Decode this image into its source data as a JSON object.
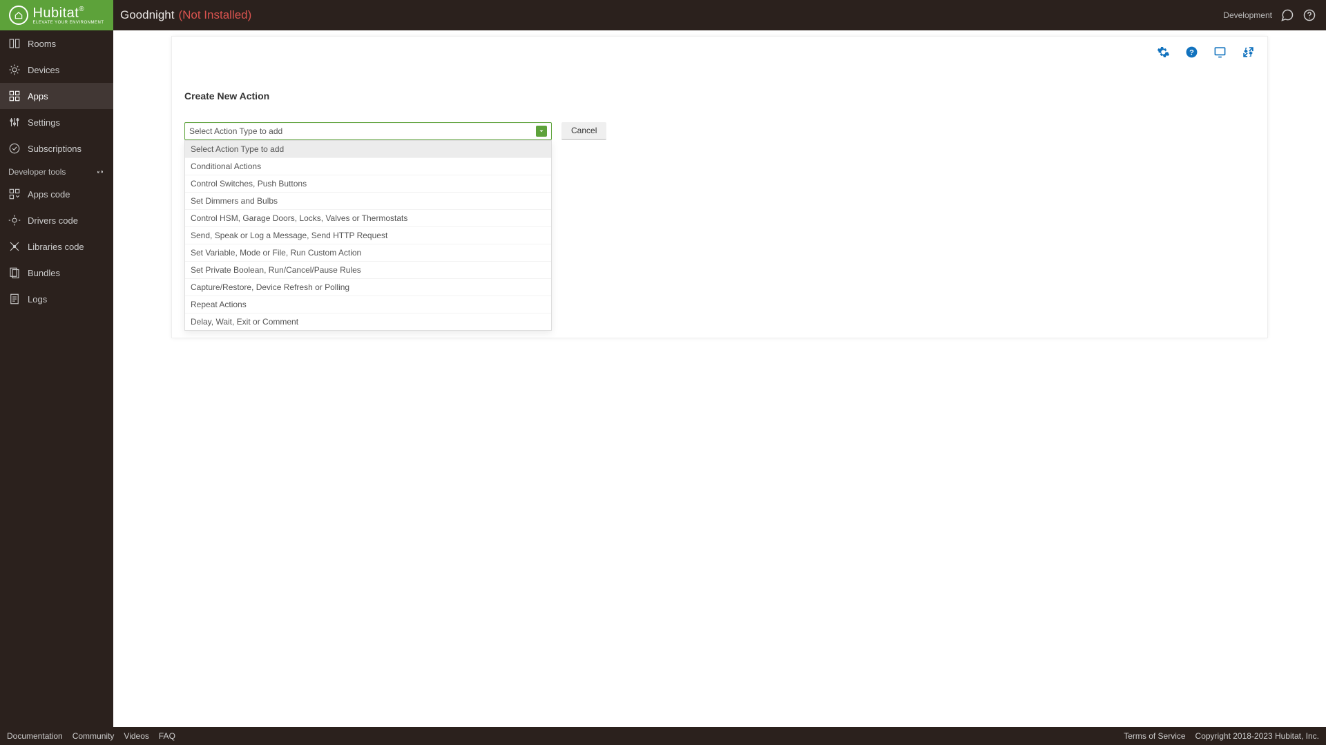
{
  "brand": {
    "name": "Hubitat",
    "tagline": "ELEVATE YOUR ENVIRONMENT"
  },
  "header": {
    "title": "Goodnight",
    "status": "(Not Installed)",
    "dev_label": "Development"
  },
  "sidebar": {
    "items": [
      {
        "label": "Rooms"
      },
      {
        "label": "Devices"
      },
      {
        "label": "Apps"
      },
      {
        "label": "Settings"
      },
      {
        "label": "Subscriptions"
      }
    ],
    "dev_section": "Developer tools",
    "dev_items": [
      {
        "label": "Apps code"
      },
      {
        "label": "Drivers code"
      },
      {
        "label": "Libraries code"
      },
      {
        "label": "Bundles"
      },
      {
        "label": "Logs"
      }
    ]
  },
  "card": {
    "section_title": "Create New Action",
    "select_placeholder": "Select Action Type to add",
    "cancel_label": "Cancel",
    "options": [
      "Select Action Type to add",
      "Conditional Actions",
      "Control Switches, Push Buttons",
      "Set Dimmers and Bulbs",
      "Control HSM, Garage Doors, Locks, Valves or Thermostats",
      "Send, Speak or Log a Message, Send HTTP Request",
      "Set Variable, Mode or File, Run Custom Action",
      "Set Private Boolean, Run/Cancel/Pause Rules",
      "Capture/Restore, Device Refresh or Polling",
      "Repeat Actions",
      "Delay, Wait, Exit or Comment"
    ]
  },
  "footer": {
    "left": [
      "Documentation",
      "Community",
      "Videos",
      "FAQ"
    ],
    "right": [
      "Terms of Service",
      "Copyright 2018-2023 Hubitat, Inc."
    ]
  },
  "colors": {
    "green": "#5da23a",
    "blue": "#1172be",
    "red": "#d9534f",
    "dark": "#2b211d",
    "arrow": "#da8a2a"
  }
}
